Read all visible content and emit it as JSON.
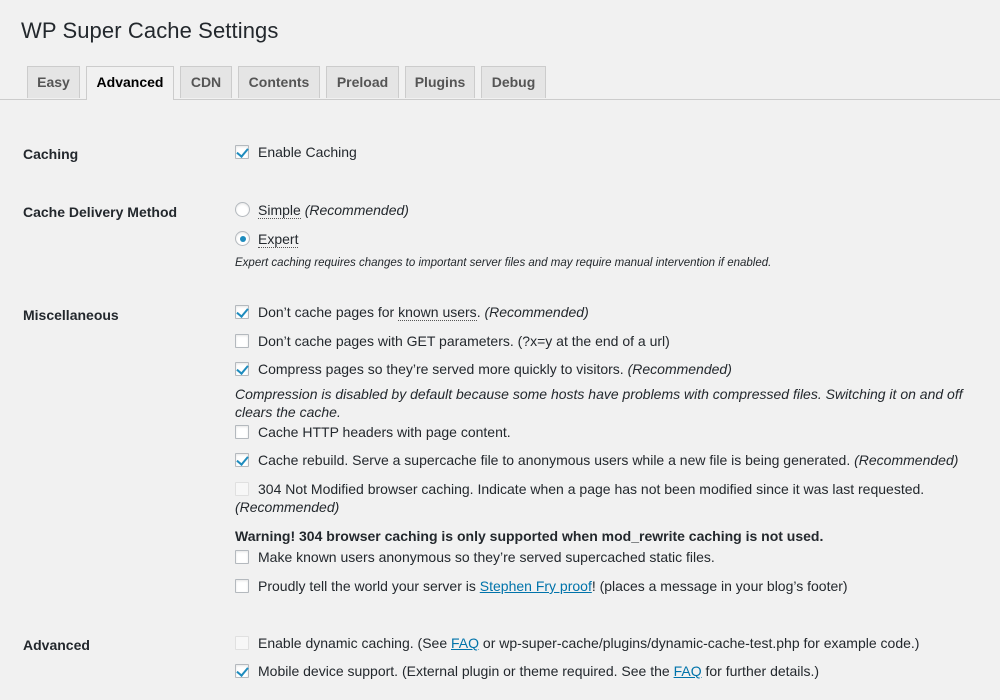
{
  "page": {
    "title": "WP Super Cache Settings"
  },
  "tabs": [
    "Easy",
    "Advanced",
    "CDN",
    "Contents",
    "Preload",
    "Plugins",
    "Debug"
  ],
  "active_tab": "Advanced",
  "sections": {
    "caching": {
      "label": "Caching",
      "enable_caching": {
        "label": "Enable Caching",
        "checked": true
      }
    },
    "delivery": {
      "label": "Cache Delivery Method",
      "simple": {
        "label": "Simple",
        "note": "(Recommended)",
        "selected": false
      },
      "expert": {
        "label": "Expert",
        "selected": true
      },
      "help": "Expert caching requires changes to important server files and may require manual intervention if enabled."
    },
    "misc": {
      "label": "Miscellaneous",
      "known_users": {
        "label_before": "Don’t cache pages for ",
        "link": "known users",
        "label_after": ".",
        "note": "(Recommended)",
        "checked": true
      },
      "get_params": {
        "label": "Don’t cache pages with GET parameters. (?x=y at the end of a url)",
        "checked": false
      },
      "compress": {
        "label": "Compress pages so they’re served more quickly to visitors.",
        "note": "(Recommended)",
        "checked": true
      },
      "compress_note": "Compression is disabled by default because some hosts have problems with compressed files. Switching it on and off clears the cache.",
      "http_headers": {
        "label": "Cache HTTP headers with page content.",
        "checked": false
      },
      "rebuild": {
        "label": "Cache rebuild. Serve a supercache file to anonymous users while a new file is being generated.",
        "note": "(Recommended)",
        "checked": true
      },
      "not_modified": {
        "label": "304 Not Modified browser caching. Indicate when a page has not been modified since it was last requested.",
        "note": "(Recommended)",
        "checked": false,
        "disabled": true
      },
      "warning": "Warning! 304 browser caching is only supported when mod_rewrite caching is not used.",
      "anonymous": {
        "label": "Make known users anonymous so they’re served supercached static files.",
        "checked": false
      },
      "proud": {
        "label_before": "Proudly tell the world your server is ",
        "link": "Stephen Fry proof",
        "label_after": "! (places a message in your blog’s footer)",
        "checked": false
      }
    },
    "advanced": {
      "label": "Advanced",
      "dynamic": {
        "label_before": "Enable dynamic caching. (See ",
        "link": "FAQ",
        "label_after": " or wp-super-cache/plugins/dynamic-cache-test.php for example code.)",
        "checked": false,
        "disabled": true
      },
      "mobile": {
        "label_before": "Mobile device support. (External plugin or theme required. See the ",
        "link": "FAQ",
        "label_after": " for further details.)",
        "checked": true
      }
    }
  },
  "colors": {
    "link": "#0073aa",
    "check": "#1e8cbe",
    "background": "#f1f1f1"
  }
}
